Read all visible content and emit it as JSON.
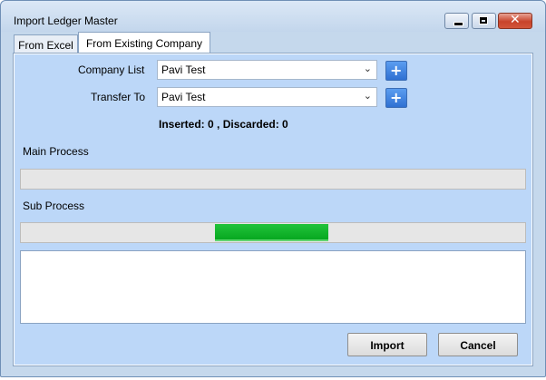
{
  "window": {
    "title": "Import Ledger Master",
    "controls": {
      "minimize_icon": "minimize-icon",
      "maximize_icon": "maximize-icon",
      "close_icon": "close-icon",
      "close_glyph": "✕"
    }
  },
  "tabs": [
    {
      "label": "From Excel",
      "active": false
    },
    {
      "label": "From Existing Company",
      "active": true
    }
  ],
  "form": {
    "company_list": {
      "label": "Company List",
      "value": "Pavi Test",
      "add_icon": "plus-icon"
    },
    "transfer_to": {
      "label": "Transfer To",
      "value": "Pavi Test",
      "add_icon": "plus-icon"
    }
  },
  "status_text": "Inserted: 0 , Discarded: 0",
  "progress": {
    "main": {
      "label": "Main Process",
      "fraction": 0
    },
    "sub": {
      "label": "Sub Process",
      "fill_start": 0.385,
      "fill_end": 0.61
    }
  },
  "log_text": "",
  "buttons": {
    "import": "Import",
    "cancel": "Cancel"
  },
  "colors": {
    "progress_fill": "#07a820",
    "panel_bg": "#bcd7f8",
    "add_button": "#2f70d2",
    "close_button": "#c8432b"
  }
}
